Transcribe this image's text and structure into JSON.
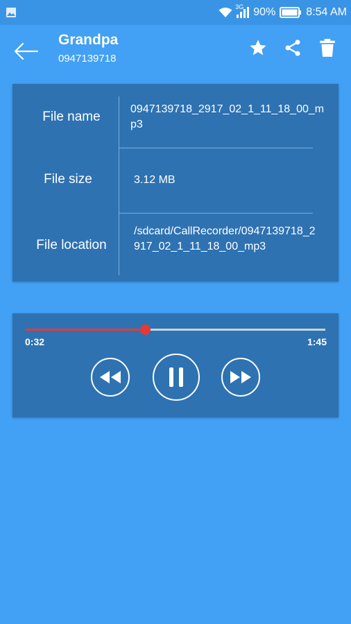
{
  "status_bar": {
    "network": "3G",
    "battery": "90%",
    "time": "8:54 AM"
  },
  "header": {
    "name": "Grandpa",
    "number": "0947139718"
  },
  "info": {
    "rows": [
      {
        "label": "File name",
        "value": "0947139718_2917_02_1_11_18_00_mp3"
      },
      {
        "label": "File size",
        "value": "3.12 MB"
      },
      {
        "label": "File location",
        "value": "/sdcard/CallRecorder/0947139718_2917_02_1_11_18_00_mp3"
      }
    ]
  },
  "player": {
    "current": "0:32",
    "total": "1:45",
    "progress": 0.4
  },
  "colors": {
    "background": "#42A0F5",
    "card": "#2E72B2",
    "seek_accent": "#E53935"
  },
  "icons": [
    "back-arrow-icon",
    "star-icon",
    "share-icon",
    "trash-icon",
    "rewind-icon",
    "pause-icon",
    "fast-forward-icon"
  ]
}
